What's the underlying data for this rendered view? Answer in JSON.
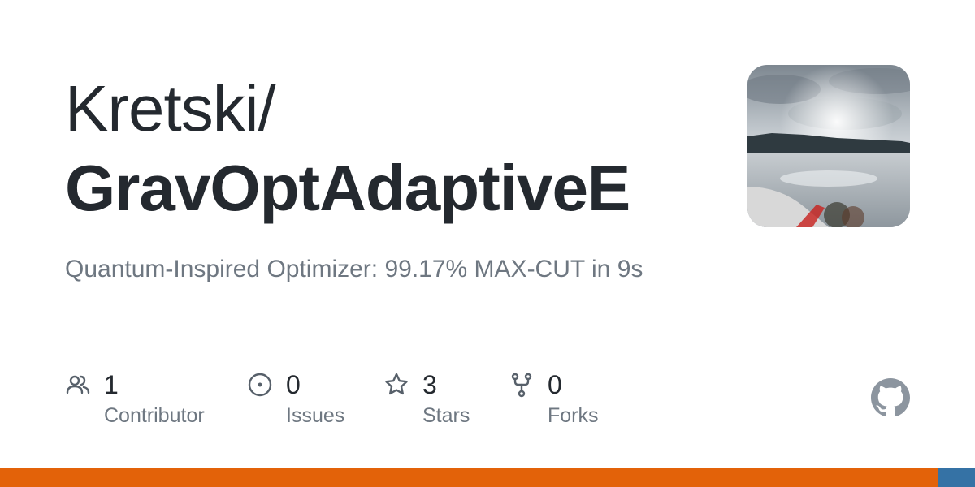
{
  "repo": {
    "owner": "Kretski/",
    "name": "GravOptAdaptiveE",
    "description": "Quantum-Inspired Optimizer: 99.17% MAX-CUT in 9s"
  },
  "stats": [
    {
      "icon": "people-icon",
      "count": "1",
      "label": "Contributor"
    },
    {
      "icon": "issue-icon",
      "count": "0",
      "label": "Issues"
    },
    {
      "icon": "star-icon",
      "count": "3",
      "label": "Stars"
    },
    {
      "icon": "fork-icon",
      "count": "0",
      "label": "Forks"
    }
  ],
  "colors": {
    "text_primary": "#24292f",
    "text_secondary": "#6e7781",
    "icon": "#57606a",
    "github_mark": "#8c959f"
  },
  "language_bar": [
    {
      "color": "#e36209",
      "share": 0.962
    },
    {
      "color": "#3572a5",
      "share": 0.038
    }
  ]
}
